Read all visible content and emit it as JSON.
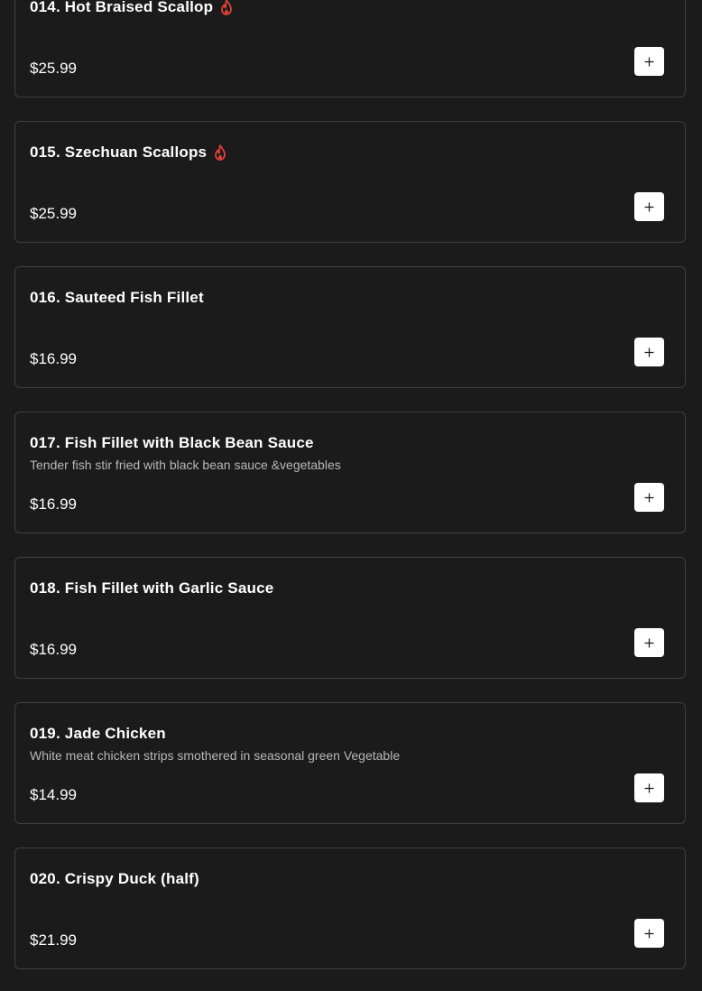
{
  "colors": {
    "background": "#1b1b1b",
    "card_border": "#3f3f3f",
    "text": "#ffffff",
    "description": "#b8b8b8",
    "spicy": "#e0403a",
    "button": "#ffffff"
  },
  "items": [
    {
      "title": "014. Hot Braised Scallop",
      "spicy": true,
      "description": "",
      "price": "$25.99",
      "add_icon": "plus-icon"
    },
    {
      "title": "015. Szechuan Scallops",
      "spicy": true,
      "description": "",
      "price": "$25.99",
      "add_icon": "plus-icon"
    },
    {
      "title": "016. Sauteed Fish Fillet",
      "spicy": false,
      "description": "",
      "price": "$16.99",
      "add_icon": "plus-icon"
    },
    {
      "title": "017. Fish Fillet with Black Bean Sauce",
      "spicy": false,
      "description": "Tender fish stir fried with black bean sauce &vegetables",
      "price": "$16.99",
      "add_icon": "plus-icon"
    },
    {
      "title": "018. Fish Fillet with Garlic Sauce",
      "spicy": false,
      "description": "",
      "price": "$16.99",
      "add_icon": "plus-icon"
    },
    {
      "title": "019. Jade Chicken",
      "spicy": false,
      "description": "White meat chicken strips smothered in seasonal green Vegetable",
      "price": "$14.99",
      "add_icon": "plus-icon"
    },
    {
      "title": "020. Crispy Duck (half)",
      "spicy": false,
      "description": "",
      "price": "$21.99",
      "add_icon": "plus-icon"
    }
  ]
}
